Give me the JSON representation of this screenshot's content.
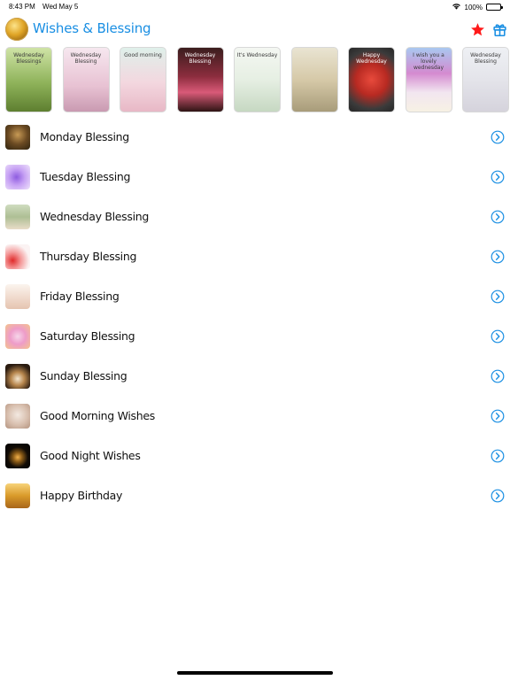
{
  "status_bar": {
    "time": "8:43 PM",
    "date": "Wed May 5",
    "battery": "100%",
    "icons": [
      "wifi-icon",
      "battery-icon"
    ]
  },
  "nav_bar": {
    "title": "Wishes & Blessing",
    "logo_icon": "app-logo",
    "favorites_icon": "star-icon",
    "gift_icon": "gift-icon",
    "accent_color": "#1a8fe3",
    "star_color": "#ff1a1a"
  },
  "carousel": {
    "items": [
      {
        "caption": "Wednesday Blessings"
      },
      {
        "caption": "Wednesday Blessing"
      },
      {
        "caption": "Good morning"
      },
      {
        "caption": "Wednesday Blessing"
      },
      {
        "caption": "It's Wednesday"
      },
      {
        "caption": ""
      },
      {
        "caption": "Happy Wednesday"
      },
      {
        "caption": "I wish you a lovely wednesday"
      },
      {
        "caption": "Wednesday Blessing"
      }
    ]
  },
  "list": {
    "items": [
      {
        "label": "Monday Blessing"
      },
      {
        "label": "Tuesday Blessing"
      },
      {
        "label": "Wednesday Blessing"
      },
      {
        "label": "Thursday Blessing"
      },
      {
        "label": "Friday Blessing"
      },
      {
        "label": "Saturday Blessing"
      },
      {
        "label": "Sunday Blessing"
      },
      {
        "label": "Good Morning Wishes"
      },
      {
        "label": "Good Night Wishes"
      },
      {
        "label": "Happy Birthday"
      }
    ],
    "chevron_icon": "chevron-right-circle-icon",
    "chevron_color": "#1a8fe3"
  }
}
